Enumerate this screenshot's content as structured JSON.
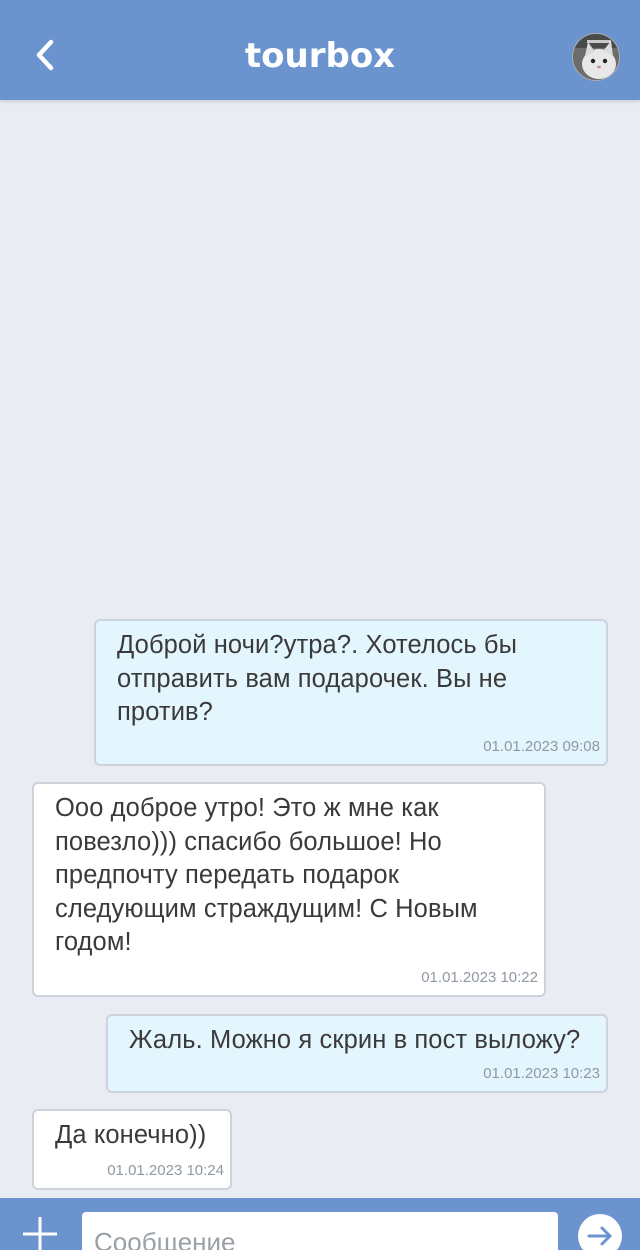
{
  "header": {
    "title": "tourbox",
    "back_icon": "chevron-left-icon",
    "avatar_icon": "cat-avatar"
  },
  "messages": [
    {
      "direction": "outgoing",
      "text": "Доброй ночи?утра?. Хотелось бы\nотправить вам подарочек. Вы не\nпротив?",
      "time": "01.01.2023 09:08"
    },
    {
      "direction": "incoming",
      "text": "Ооо доброе утро! Это ж мне как\nповезло))) спасибо большое! Но\nпредпочту передать подарок\nследующим страждущим! С Новым\nгодом!",
      "time": "01.01.2023 10:22"
    },
    {
      "direction": "outgoing",
      "text": "Жаль. Можно я скрин в пост выложу?",
      "time": "01.01.2023 10:23"
    },
    {
      "direction": "incoming",
      "text": "Да конечно))",
      "time": "01.01.2023 10:24"
    }
  ],
  "composer": {
    "placeholder": "Сообщение",
    "value": "",
    "attach_icon": "plus-icon",
    "send_icon": "arrow-right-icon"
  },
  "colors": {
    "header_bg": "#6b94cf",
    "page_bg": "#e9ecf3",
    "outgoing_bubble": "#e3f5fd",
    "incoming_bubble": "#ffffff",
    "timestamp": "#9098a3"
  }
}
